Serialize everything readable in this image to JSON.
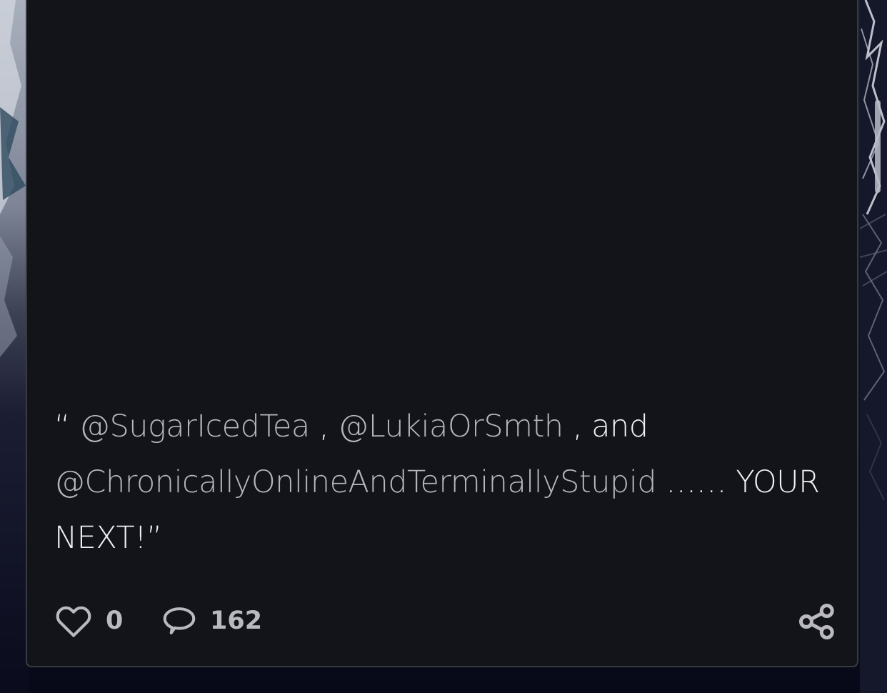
{
  "post": {
    "body": {
      "open_quote": "“ ",
      "mention_1": "@SugarIcedTea",
      "sep_1": " , ",
      "mention_2": "@LukiaOrSmth",
      "sep_2": " , and ",
      "mention_3": "@ChronicallyOnlineAndTerminallyStupid",
      "ending": " …… YOUR NEXT!”"
    },
    "actions": {
      "like_count": "0",
      "comment_count": "162"
    }
  },
  "icons": {
    "like": "heart-outline-icon",
    "comment": "speech-bubble-icon",
    "share": "share-icon"
  },
  "colors": {
    "card_background": "#131419",
    "card_border": "#3a3b41",
    "body_text": "#f1f1f3",
    "mention_text": "#b6b6bc",
    "action_text": "#b9b9bf"
  }
}
